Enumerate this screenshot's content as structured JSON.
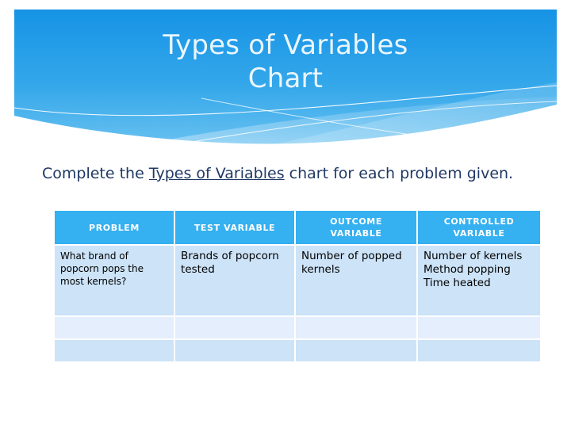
{
  "slide": {
    "title_line_1": "Types of Variables",
    "title_line_2": "Chart",
    "title_full": "Types of Variables\nChart",
    "instruction_prefix": "Complete the ",
    "instruction_emphasis": "Types of Variables",
    "instruction_suffix": " chart for each problem given."
  },
  "colors": {
    "banner_blue_top": "#1f9ae6",
    "banner_blue_bottom": "#6cc2f0",
    "table_header_blue": "#35b0f0",
    "row_blue": "#cce3f8",
    "row_blue_light": "#e4eefc",
    "instruction_navy": "#1f3864",
    "title_white": "#eaf6fd"
  },
  "table": {
    "headers": [
      "PROBLEM",
      "TEST VARIABLE",
      "OUTCOME VARIABLE",
      "CONTROLLED VARIABLE"
    ],
    "header_lines": [
      [
        "PROBLEM"
      ],
      [
        "TEST VARIABLE"
      ],
      [
        "OUTCOME",
        "VARIABLE"
      ],
      [
        "CONTROLLED",
        "VARIABLE"
      ]
    ],
    "rows": [
      {
        "filled": true,
        "cells": [
          [
            "What brand of popcorn pops the most kernels?"
          ],
          [
            "Brands of popcorn tested"
          ],
          [
            "Number of popped kernels"
          ],
          [
            "Number of kernels",
            "Method popping",
            "Time heated"
          ]
        ]
      },
      {
        "filled": false,
        "cells": [
          [
            ""
          ],
          [
            ""
          ],
          [
            ""
          ],
          [
            ""
          ]
        ]
      },
      {
        "filled": false,
        "cells": [
          [
            ""
          ],
          [
            ""
          ],
          [
            ""
          ],
          [
            ""
          ]
        ]
      }
    ]
  }
}
